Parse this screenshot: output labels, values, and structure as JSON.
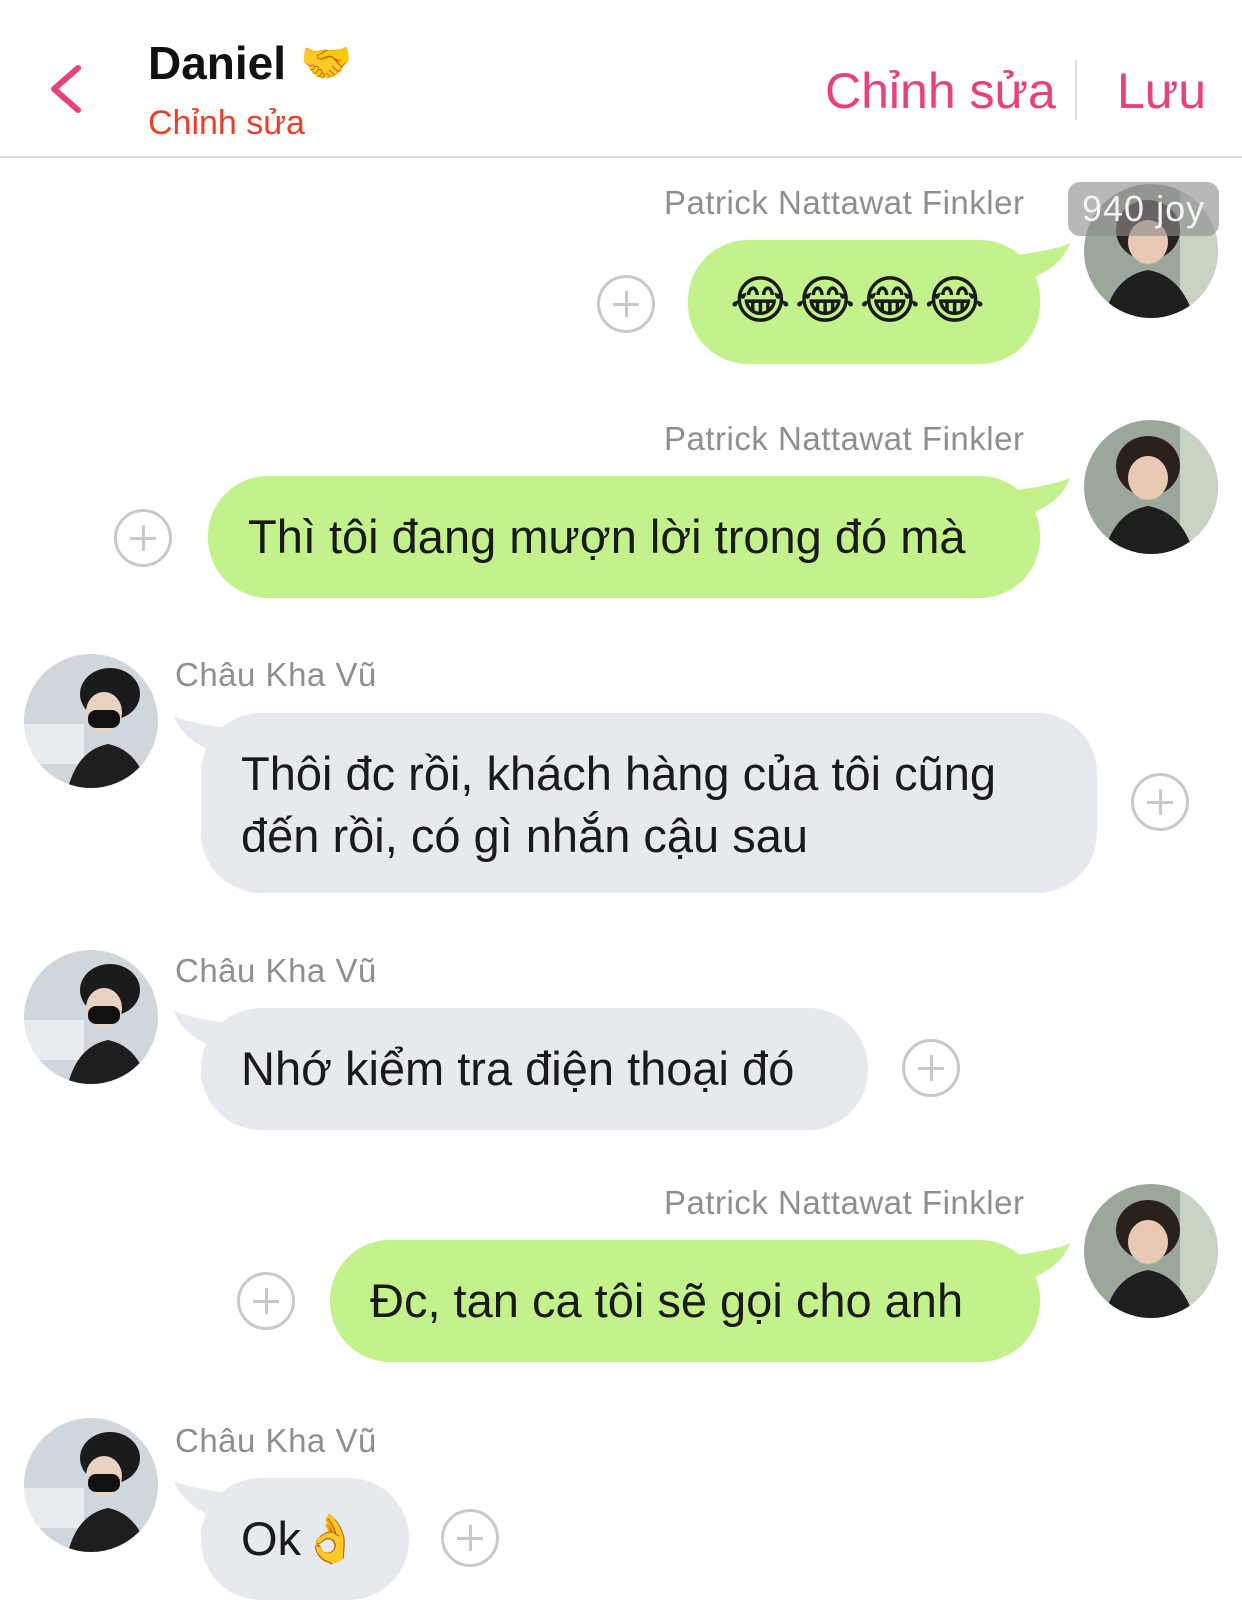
{
  "header": {
    "title": "Daniel",
    "title_emoji": "🤝",
    "subtitle": "Chỉnh sửa",
    "edit_label": "Chỉnh sửa",
    "save_label": "Lưu"
  },
  "badge": "940 joy",
  "messages": [
    {
      "side": "right",
      "sender": "Patrick Nattawat Finkler",
      "text": "😂😂😂😂"
    },
    {
      "side": "right",
      "sender": "Patrick Nattawat Finkler",
      "text": "Thì tôi đang mượn lời trong đó mà"
    },
    {
      "side": "left",
      "sender": "Châu Kha Vũ",
      "lines": [
        "Thôi đc rồi, khách hàng của tôi cũng",
        "đến rồi, có gì nhắn cậu sau"
      ]
    },
    {
      "side": "left",
      "sender": "Châu Kha Vũ",
      "text": "Nhớ kiểm tra điện thoại đó"
    },
    {
      "side": "right",
      "sender": "Patrick Nattawat Finkler",
      "text": "Đc, tan ca tôi sẽ gọi cho anh"
    },
    {
      "side": "left",
      "sender": "Châu Kha Vũ",
      "text": "Ok",
      "emoji": "👌"
    }
  ],
  "colors": {
    "accent": "#e8417e",
    "subtitle": "#ea3f2a",
    "bubble_right": "#c3f18c",
    "bubble_left": "#e6e9ed"
  },
  "icons": [
    "chevron-left-icon",
    "handshake-icon",
    "add-reaction-icon",
    "avatar"
  ]
}
